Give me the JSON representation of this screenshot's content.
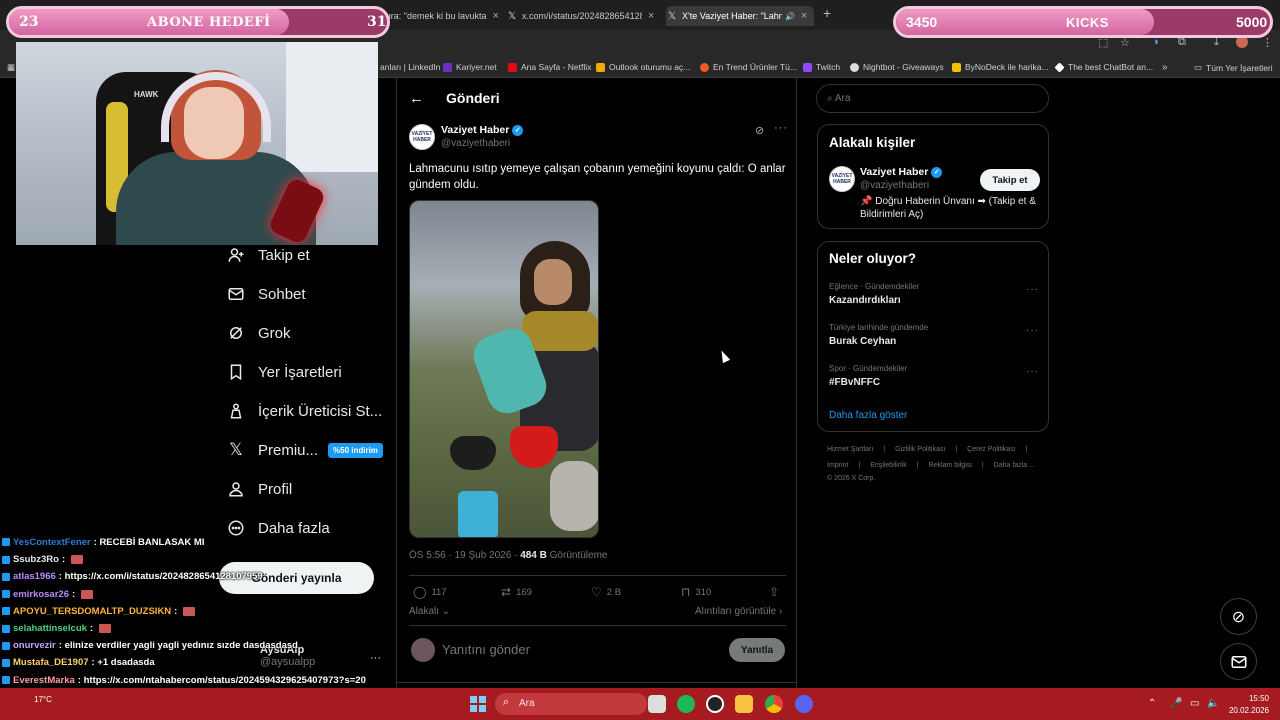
{
  "browser": {
    "tabs": [
      {
        "label": "X'te Bura: \"demek ki bu lavukta",
        "close": "×"
      },
      {
        "label": "x.com/i/status/2024828654128",
        "close": "×"
      },
      {
        "label": "X'te Vaziyet Haber: \"Lahma",
        "close": "×"
      }
    ],
    "new_tab": "+",
    "bookmarks": [
      {
        "label": "anları | LinkedIn",
        "color": "#0a66c2"
      },
      {
        "label": "Kariyer.net",
        "color": "#6e2fc9"
      },
      {
        "label": "Ana Sayfa - Netflix",
        "color": "#e50914"
      },
      {
        "label": "Outlook oturumu aç...",
        "color": "#f2a900"
      },
      {
        "label": "En Trend Ürünler Tü...",
        "color": "#f15a22"
      },
      {
        "label": "Twitch",
        "color": "#9146ff"
      },
      {
        "label": "Nightbot - Giveaways",
        "color": "#dddddd"
      },
      {
        "label": "ByNoDeck ile harika...",
        "color": "#f2c200"
      },
      {
        "label": "The best ChatBot an...",
        "color": "#ffffff"
      }
    ],
    "bookmark_overflow": "»",
    "all_bookmarks": "Tüm Yer İşaretleri"
  },
  "overlays": {
    "sub_goal": {
      "current": "23",
      "title": "ABONE HEDEFİ",
      "target": "31",
      "progress": 0.74
    },
    "kicks_goal": {
      "current": "3450",
      "title": "KICKS",
      "target": "5000",
      "progress": 0.69
    }
  },
  "nav": {
    "items": [
      {
        "label": "Takip et",
        "icon": "person-add-icon"
      },
      {
        "label": "Sohbet",
        "icon": "mail-icon"
      },
      {
        "label": "Grok",
        "icon": "grok-icon"
      },
      {
        "label": "Yer İşaretleri",
        "icon": "bookmark-icon"
      },
      {
        "label": "İçerik Üreticisi St...",
        "icon": "creator-icon"
      },
      {
        "label": "Premiu...",
        "icon": "x-logo-icon",
        "badge": "%50 indirim"
      },
      {
        "label": "Profil",
        "icon": "profile-icon"
      },
      {
        "label": "Daha fazla",
        "icon": "more-circle-icon"
      }
    ],
    "post_button": "Gönderi yayınla",
    "account_name": "AysuAlp",
    "account_handle": "@aysualpp"
  },
  "chat": [
    {
      "user": "YesContextFener",
      "color": "#2e7bd6",
      "message": "RECEBİ BANLASAK MI"
    },
    {
      "user": "Ssubz3Ro",
      "color": "#e8e8e8",
      "message": ""
    },
    {
      "user": "atlas1966",
      "color": "#b98cff",
      "message": "https://x.com/i/status/2024828654128107959"
    },
    {
      "user": "emirkosar26",
      "color": "#b98cff",
      "message": ""
    },
    {
      "user": "APOYU_TERSDOMALTP_DUZSIKN",
      "color": "#ffb23a",
      "message": ""
    },
    {
      "user": "selahattinselcuk",
      "color": "#4ad27a",
      "message": ""
    },
    {
      "user": "onurvezir",
      "color": "#c9a1ff",
      "message": "elinize verdiler yagli yagli yedınız sızde dasdasdasd"
    },
    {
      "user": "Mustafa_DE1907",
      "color": "#ffd166",
      "message": "+1 dsadasda"
    },
    {
      "user": "EverestMarka",
      "color": "#ff9aa8",
      "message": "https://x.com/ntahabercom/status/2024594329625407973?s=20"
    },
    {
      "user": "Ssubz3Ro",
      "color": "#e8e8e8",
      "message": ""
    }
  ],
  "post": {
    "header_title": "Gönderi",
    "author_name": "Vaziyet Haber",
    "author_handle": "@vaziyethaberi",
    "avatar_text": "VAZİYET HABER",
    "text": "Lahmacunu ısıtıp yemeye çalışan çobanın yemeğini koyunu çaldı: O anlar gündem oldu.",
    "timestamp": "ÖS 5:56 · 19 Şub 2026 · ",
    "views_count": "484 B",
    "views_label": " Görüntüleme",
    "replies": "117",
    "reposts": "169",
    "likes": "2 B",
    "bookmarks": "310",
    "sort_label": "Alakalı",
    "quotes_label": "Alıntıları görüntüle ›",
    "reply_placeholder": "Yanıtını gönder",
    "reply_button": "Yanıtla"
  },
  "sidebar": {
    "search_placeholder": "Ara",
    "relevant_title": "Alakalı kişiler",
    "relevant": {
      "name": "Vaziyet Haber",
      "handle": "@vaziyethaberi",
      "follow": "Takip et",
      "bio": "📌 Doğru Haberin Ünvanı ➡ (Takip et & Bildirimleri Aç)"
    },
    "trends_title": "Neler oluyor?",
    "trends": [
      {
        "category": "Eğlence · Gündemdekiler",
        "name": "Kazandırdıkları"
      },
      {
        "category": "Türkiye tarihinde gündemde",
        "name": "Burak Ceyhan"
      },
      {
        "category": "Spor · Gündemdekiler",
        "name": "#FBvNFFC"
      }
    ],
    "show_more": "Daha fazla göster",
    "footer_row1": [
      "Hizmet Şartları",
      "|",
      "Gizlilik Politikası",
      "|",
      "Çerez Politikası",
      "|"
    ],
    "footer_row2": [
      "Imprint",
      "|",
      "Erişilebilirlik",
      "|",
      "Reklam bilgisi",
      "|",
      "Daha fazla ..."
    ],
    "copyright": "© 2026 X Corp."
  },
  "taskbar": {
    "weather": "17°C",
    "search_placeholder": "Ara",
    "time": "15:50",
    "date": "20.02.2026"
  }
}
